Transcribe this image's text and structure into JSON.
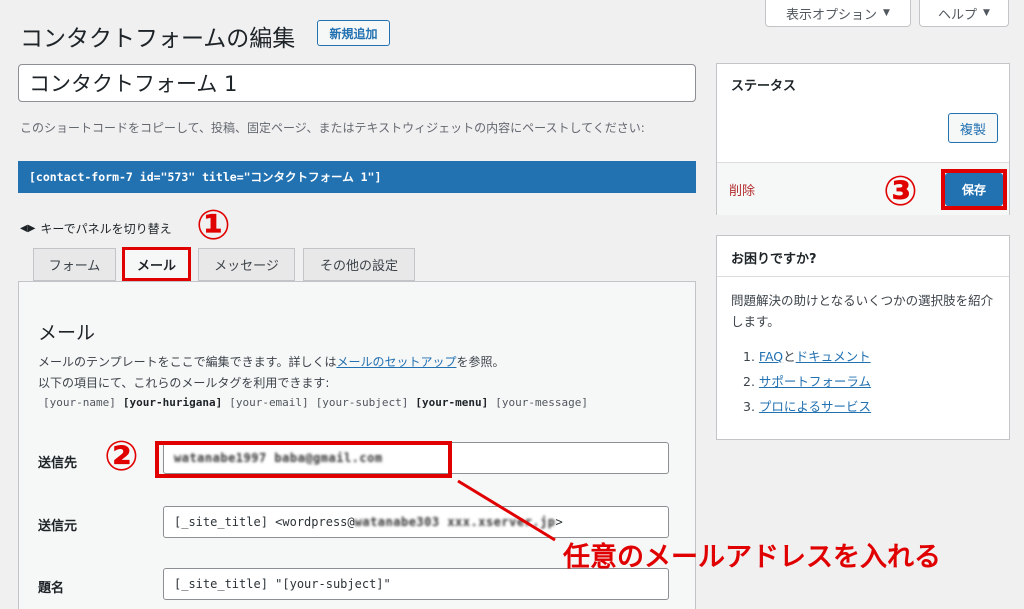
{
  "header": {
    "title": "コンタクトフォームの編集",
    "add_new": "新規追加",
    "screen_options": "表示オプション",
    "help": "ヘルプ"
  },
  "form": {
    "title_value": "コンタクトフォーム 1",
    "shortcode_desc": "このショートコードをコピーして、投稿、固定ページ、またはテキストウィジェットの内容にペーストしてください:",
    "shortcode": "[contact-form-7 id=\"573\" title=\"コンタクトフォーム 1\"]",
    "keyboard_hint": "キーでパネルを切り替え"
  },
  "tabs": [
    {
      "label": "フォーム"
    },
    {
      "label": "メール"
    },
    {
      "label": "メッセージ"
    },
    {
      "label": "その他の設定"
    }
  ],
  "mail": {
    "heading": "メール",
    "desc1_pre": "メールのテンプレートをここで編集できます。詳しくは",
    "desc1_link": "メールのセットアップ",
    "desc1_post": "を参照。",
    "desc2": "以下の項目にて、これらのメールタグを利用できます:",
    "tags": [
      {
        "text": "[your-name]",
        "strong": false
      },
      {
        "text": "[your-hurigana]",
        "strong": true
      },
      {
        "text": "[your-email]",
        "strong": false
      },
      {
        "text": "[your-subject]",
        "strong": false
      },
      {
        "text": "[your-menu]",
        "strong": true
      },
      {
        "text": "[your-message]",
        "strong": false
      }
    ],
    "to_label": "送信先",
    "to_value": "watanabe1997 baba@gmail.com",
    "from_label": "送信元",
    "from_value_pre": "[_site_title] <wordpress@",
    "from_value_blur": "watanabe303 xxx.xserver.jp",
    "from_value_post": ">",
    "subject_label": "題名",
    "subject_value": "[_site_title] \"[your-subject]\""
  },
  "status": {
    "heading": "ステータス",
    "copy": "複製",
    "delete": "削除",
    "save": "保存"
  },
  "help_box": {
    "heading": "お困りですか?",
    "desc": "問題解決の助けとなるいくつかの選択肢を紹介します。",
    "items": [
      {
        "num": "1.",
        "link1": "FAQ",
        "mid": "と",
        "link2": "ドキュメント"
      },
      {
        "num": "2.",
        "link1": "サポートフォーラム"
      },
      {
        "num": "3.",
        "link1": "プロによるサービス"
      }
    ]
  },
  "annotations": {
    "n1": "①",
    "n2": "②",
    "n3": "③",
    "note": "任意のメールアドレスを入れる",
    "color": "#e00000"
  }
}
